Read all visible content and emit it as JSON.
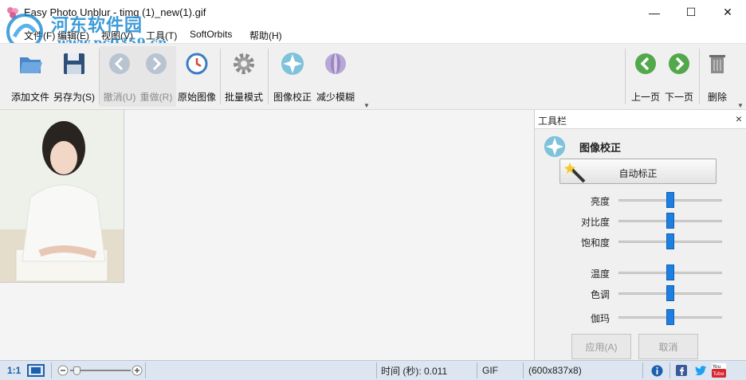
{
  "window": {
    "title": "Easy Photo Unblur - timg (1)_new(1).gif",
    "minimize_glyph": "—",
    "maximize_glyph": "☐",
    "close_glyph": "✕"
  },
  "watermark": {
    "text": "河东软件园",
    "url": "www.pc0359.cn"
  },
  "menu": [
    {
      "label": "文件(F)"
    },
    {
      "label": "编辑(E)"
    },
    {
      "label": "视图(V)"
    },
    {
      "label": "工具(T)"
    },
    {
      "label": "SoftOrbits"
    },
    {
      "label": "帮助(H)"
    }
  ],
  "toolbar": {
    "add_file": "添加文件",
    "save_as": "另存为(S)",
    "undo": "撤消(U)",
    "redo": "重做(R)",
    "original": "原始图像",
    "batch": "批量模式",
    "correct": "图像校正",
    "reduce_blur": "减少模糊",
    "prev_page": "上一页",
    "next_page": "下一页",
    "delete": "删除"
  },
  "panel": {
    "title": "工具栏",
    "section_title": "图像校正",
    "auto_correct": "自动标正",
    "sliders": [
      {
        "label": "亮度",
        "value": 0.5
      },
      {
        "label": "对比度",
        "value": 0.5
      },
      {
        "label": "饱和度",
        "value": 0.5
      },
      {
        "label": "温度",
        "value": 0.5
      },
      {
        "label": "色调",
        "value": 0.5
      },
      {
        "label": "伽玛",
        "value": 0.5
      }
    ],
    "apply": "应用(A)",
    "cancel": "取消"
  },
  "statusbar": {
    "ratio": "1:1",
    "time": "时间 (秒): 0.011",
    "format": "GIF",
    "size": "(600x837x8)",
    "zoom_level": 0.1
  },
  "colors": {
    "accent": "#1e7fe0",
    "statusbar": "#dde6f0",
    "watermark": "#1c8ad1"
  }
}
